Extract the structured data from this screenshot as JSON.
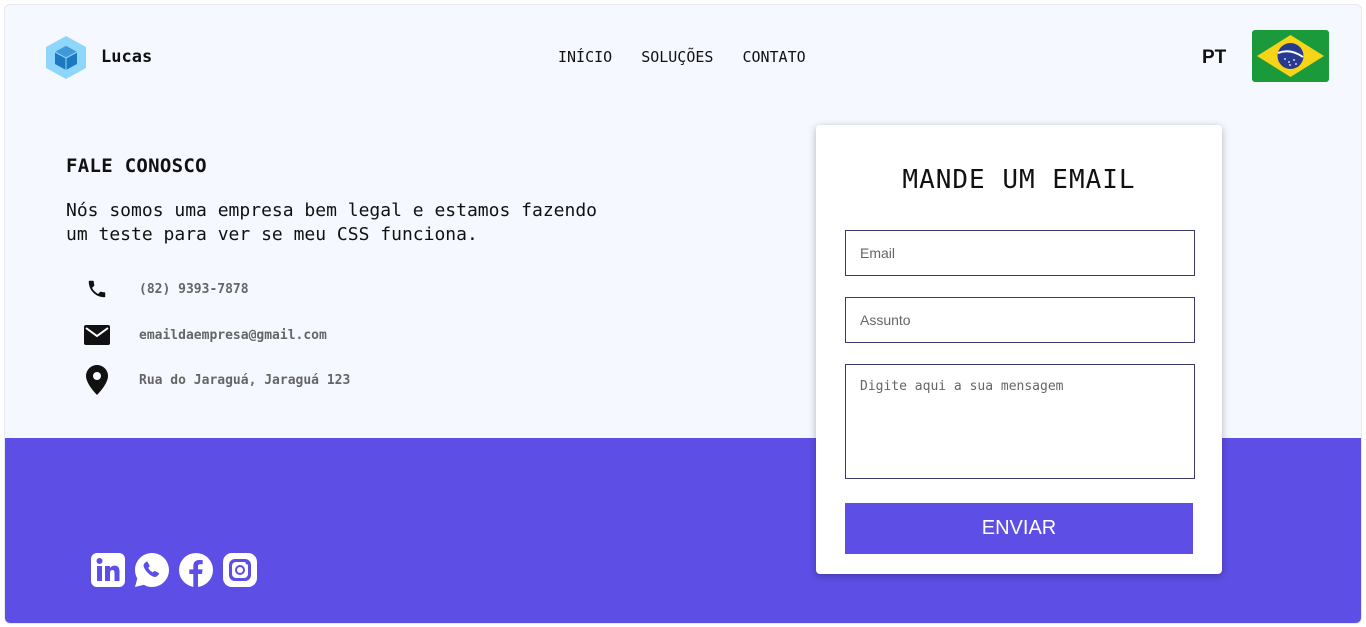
{
  "header": {
    "brand": "Lucas",
    "nav": [
      "INÍCIO",
      "SOLUÇÕES",
      "CONTATO"
    ],
    "language": "PT",
    "flag": "brazil-flag"
  },
  "contact": {
    "heading": "FALE CONOSCO",
    "description": "Nós somos uma empresa bem legal e estamos fazendo um teste para ver se meu CSS funciona.",
    "phone": "(82) 9393-7878",
    "email": "emaildaempresa@gmail.com",
    "address": "Rua do Jaraguá, Jaraguá 123"
  },
  "form": {
    "title": "MANDE UM EMAIL",
    "email_placeholder": "Email",
    "subject_placeholder": "Assunto",
    "message_placeholder": "Digite aqui a sua mensagem",
    "submit_label": "ENVIAR"
  },
  "social": [
    "linkedin-icon",
    "whatsapp-icon",
    "facebook-icon",
    "instagram-icon"
  ],
  "colors": {
    "accent": "#5d4ee6",
    "background": "#f5f8ff",
    "card": "#ffffff"
  }
}
